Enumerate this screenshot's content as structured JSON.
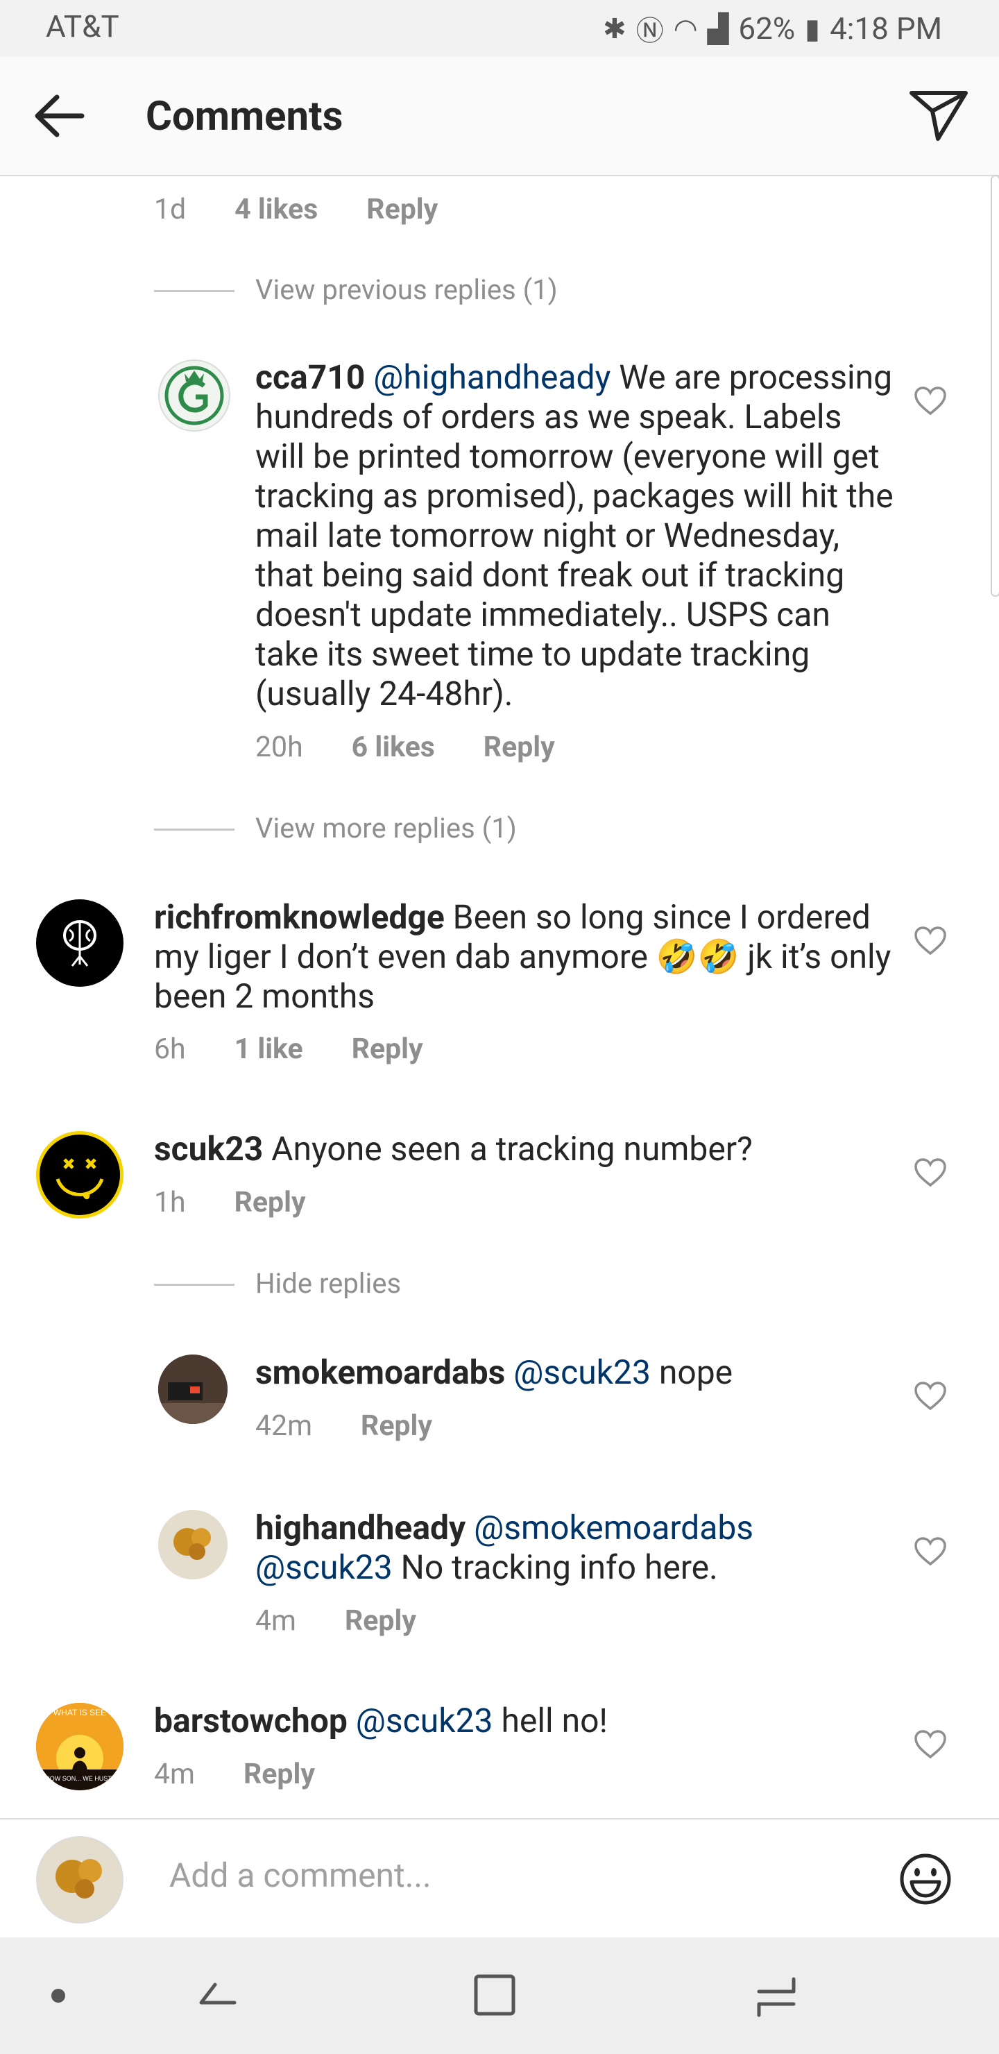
{
  "status_bar": {
    "carrier": "AT&T",
    "battery": "62%",
    "time": "4:18 PM"
  },
  "header": {
    "title": "Comments"
  },
  "top_meta": {
    "time": "1d",
    "likes": "4 likes",
    "reply": "Reply"
  },
  "view_previous": "View previous replies (1)",
  "comments": [
    {
      "user": "cca710",
      "mention": "@highandheady",
      "text": "We are processing hundreds of orders as we speak. Labels will be printed tomorrow (everyone will get tracking as promised), packages will hit the mail late tomorrow night or Wednesday, that being said dont freak out if tracking doesn't update immediately.. USPS can take its sweet time to update tracking (usually 24-48hr).",
      "time": "20h",
      "likes": "6 likes",
      "reply": "Reply"
    },
    {
      "user": "richfromknowledge",
      "text": "Been so long since I ordered my liger I don’t even dab anymore 🤣🤣 jk it’s only been 2 months",
      "time": "6h",
      "likes": "1 like",
      "reply": "Reply"
    },
    {
      "user": "scuk23",
      "text": "Anyone seen a tracking number?",
      "time": "1h",
      "reply": "Reply"
    },
    {
      "user": "smokemoardabs",
      "mention": "@scuk23",
      "text": "nope",
      "time": "42m",
      "reply": "Reply"
    },
    {
      "user": "highandheady",
      "mention": "@smokemoardabs @scuk23",
      "text": "No tracking info here.",
      "time": "4m",
      "reply": "Reply"
    },
    {
      "user": "barstowchop",
      "mention": "@scuk23",
      "text": "hell no!",
      "time": "4m",
      "reply": "Reply"
    }
  ],
  "view_more": "View more replies (1)",
  "hide_replies": "Hide replies",
  "avatar_text": {
    "barstowchop_top": "WHAT IS SEE",
    "barstowchop_bottom": "N'T KNOW SON... WE HUSTLERS!"
  },
  "compose": {
    "placeholder": "Add a comment..."
  },
  "colors": {
    "mention": "#003569",
    "meta": "#8e8e8e",
    "text": "#262626"
  }
}
